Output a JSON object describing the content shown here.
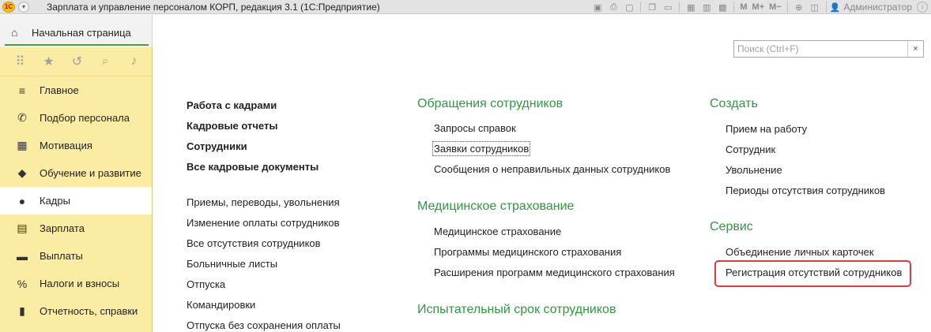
{
  "window": {
    "title": "Зарплата и управление персоналом КОРП, редакция 3.1  (1С:Предприятие)",
    "logo_text": "1С",
    "menu_glyph": "▾",
    "toolbar_icons": [
      "save-icon",
      "print-icon",
      "preview-icon",
      "copy-icon",
      "paste-icon",
      "table-icon",
      "calendar-icon",
      "calculator-icon"
    ],
    "memory_buttons": [
      "M",
      "M+",
      "M−"
    ],
    "user": "Администратор"
  },
  "home_tab": {
    "label": "Начальная страница"
  },
  "sidebar": {
    "quick_icons": [
      "apps-icon",
      "star-icon",
      "history-icon",
      "search-icon",
      "bell-icon"
    ],
    "items": [
      {
        "label": "Главное",
        "icon": "menu-lines-icon",
        "glyph": "≡"
      },
      {
        "label": "Подбор персонала",
        "icon": "phone-icon",
        "glyph": "✆"
      },
      {
        "label": "Мотивация",
        "icon": "gift-icon",
        "glyph": "▦"
      },
      {
        "label": "Обучение и развитие",
        "icon": "graduation-cap-icon",
        "glyph": "◆"
      },
      {
        "label": "Кадры",
        "icon": "people-icon",
        "glyph": "●"
      },
      {
        "label": "Зарплата",
        "icon": "ledger-icon",
        "glyph": "▤"
      },
      {
        "label": "Выплаты",
        "icon": "wallet-icon",
        "glyph": "▬"
      },
      {
        "label": "Налоги и взносы",
        "icon": "percent-icon",
        "glyph": "%"
      },
      {
        "label": "Отчетность, справки",
        "icon": "chart-icon",
        "glyph": "▮"
      }
    ],
    "active_index": 4
  },
  "search": {
    "placeholder": "Поиск (Ctrl+F)",
    "value": "",
    "clear_glyph": "×"
  },
  "col1": {
    "bold_links": [
      "Работа с кадрами",
      "Кадровые отчеты",
      "Сотрудники",
      "Все кадровые документы"
    ],
    "links": [
      "Приемы, переводы, увольнения",
      "Изменение оплаты сотрудников",
      "Все отсутствия сотрудников",
      "Больничные листы",
      "Отпуска",
      "Командировки",
      "Отпуска без сохранения оплаты"
    ]
  },
  "col2": {
    "sections": [
      {
        "title": "Обращения сотрудников",
        "items": [
          "Запросы справок",
          "Заявки сотрудников",
          "Сообщения о неправильных данных сотрудников"
        ]
      },
      {
        "title": "Медицинское страхование",
        "items": [
          "Медицинское страхование",
          "Программы медицинского страхования",
          "Расширения программ медицинского страхования"
        ]
      },
      {
        "title": "Испытательный срок сотрудников",
        "items": []
      }
    ]
  },
  "col3": {
    "sections": [
      {
        "title": "Создать",
        "items": [
          "Прием на работу",
          "Сотрудник",
          "Увольнение",
          "Периоды отсутствия сотрудников"
        ]
      },
      {
        "title": "Сервис",
        "items": [
          "Объединение личных карточек",
          "Регистрация отсутствий сотрудников"
        ]
      }
    ]
  },
  "colors": {
    "accent_green": "#2e9a3e",
    "sidebar_bg": "#fbeca3",
    "highlight_red": "#e03a3a"
  }
}
